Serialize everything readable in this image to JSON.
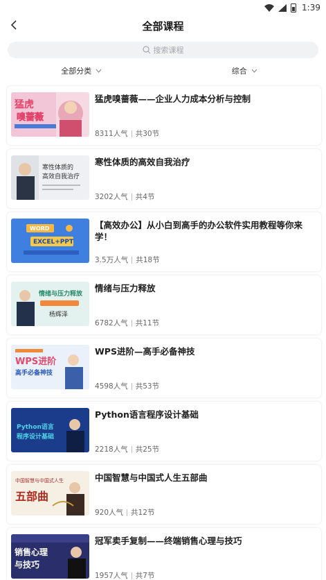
{
  "status_bar": {
    "time": "1:39"
  },
  "header": {
    "title": "全部课程",
    "back_icon": "chevron-left-icon"
  },
  "search": {
    "placeholder": "搜索课程",
    "icon": "search-icon"
  },
  "filters": [
    {
      "label": "全部分类",
      "icon": "chevron-down-icon"
    },
    {
      "label": "综合",
      "icon": "chevron-down-icon"
    }
  ],
  "courses": [
    {
      "title": "猛虎嗅蔷薇——企业人力成本分析与控制",
      "popularity": "8311人气",
      "lessons": "共30节",
      "thumb_text": [
        "猛虎",
        "嗅蔷薇"
      ]
    },
    {
      "title": "寒性体质的高效自我治疗",
      "popularity": "3202人气",
      "lessons": "共4节",
      "thumb_text": [
        "寒性体质的",
        "高效自我治疗"
      ]
    },
    {
      "title": "【高效办公】从小白到高手的办公软件实用教程等你来学！",
      "popularity": "3.5万人气",
      "lessons": "共18节",
      "thumb_text": [
        "WORD",
        "EXCEL+PPT"
      ]
    },
    {
      "title": "情绪与压力释放",
      "popularity": "6782人气",
      "lessons": "共11节",
      "thumb_text": [
        "情绪与压力释放",
        "杨辉泽"
      ]
    },
    {
      "title": "WPS进阶—高手必备神技",
      "popularity": "4598人气",
      "lessons": "共53节",
      "thumb_text": [
        "WPS进阶",
        "高手必备神技"
      ]
    },
    {
      "title": "Python语言程序设计基础",
      "popularity": "2218人气",
      "lessons": "共25节",
      "thumb_text": [
        "Python语言",
        "程序设计基础"
      ]
    },
    {
      "title": "中国智慧与中国式人生五部曲",
      "popularity": "920人气",
      "lessons": "共12节",
      "thumb_text": [
        "中国智慧与中国式人生",
        "五部曲"
      ]
    },
    {
      "title": "冠军卖手复制——终端销售心理与技巧",
      "popularity": "1957人气",
      "lessons": "共7节",
      "thumb_text": [
        "销售心理",
        "与技巧"
      ]
    }
  ],
  "colors": {
    "accent": "#1a1a1a",
    "muted": "#666666",
    "search_bg": "#f1f2f4"
  }
}
